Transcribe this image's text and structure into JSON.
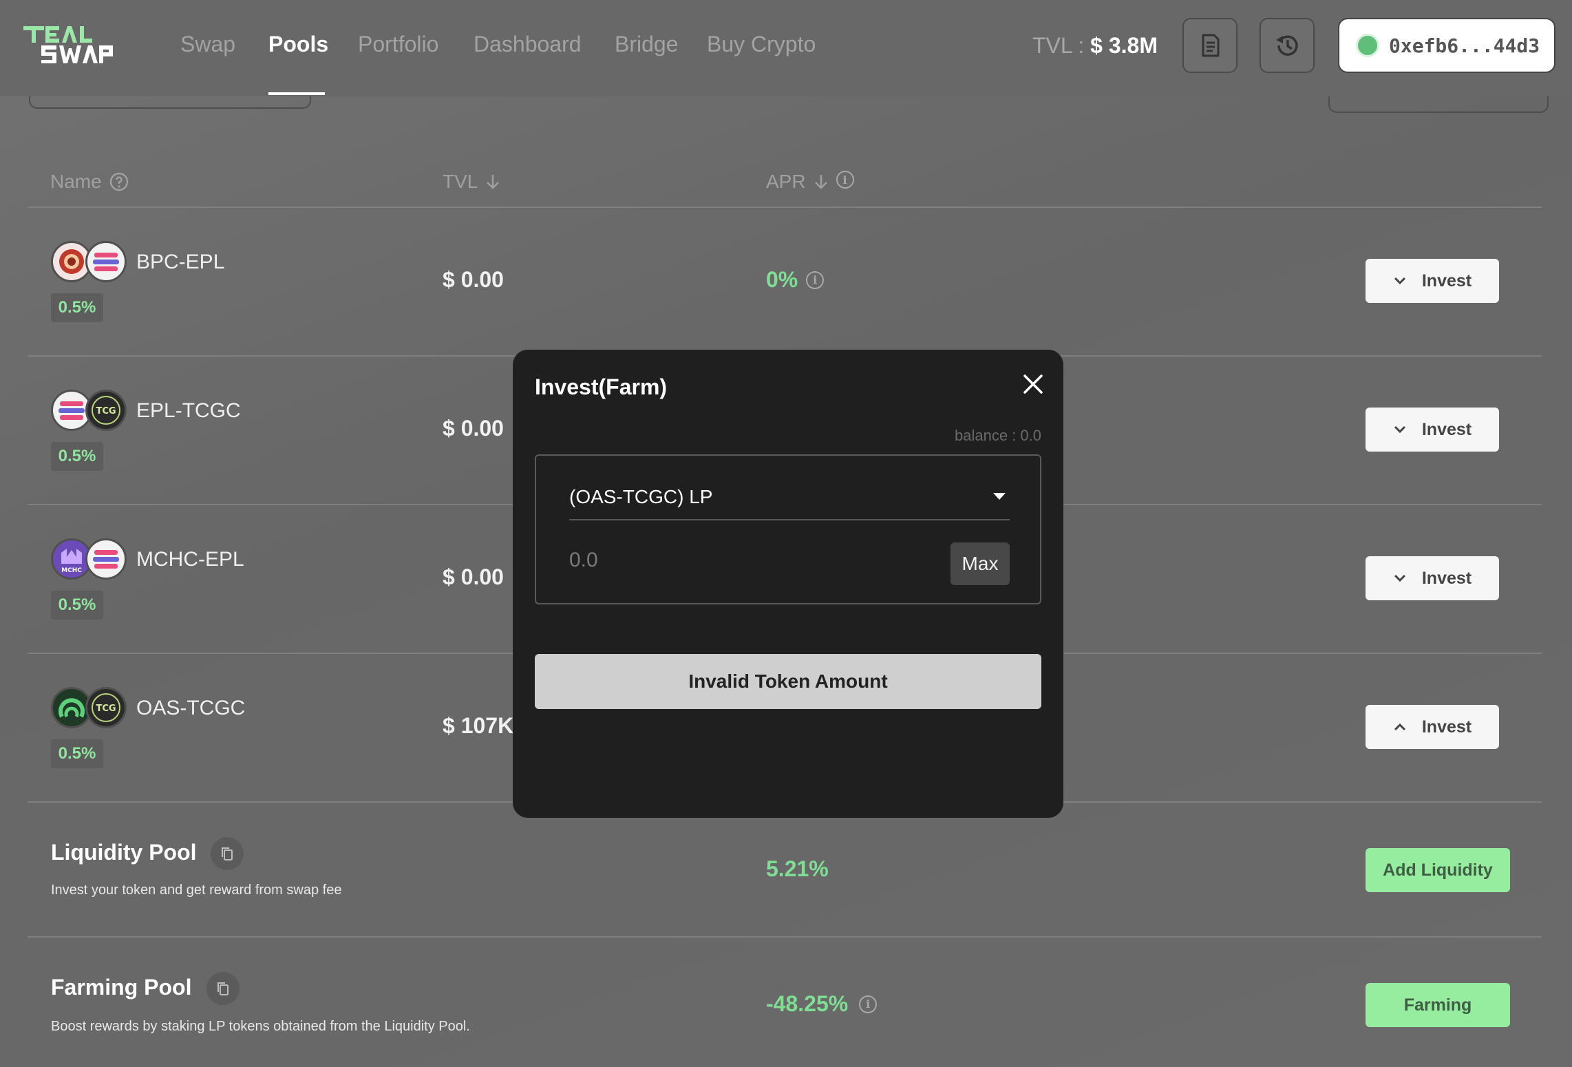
{
  "nav": {
    "logo_text": "TEAL SWAP",
    "links": [
      "Swap",
      "Pools",
      "Portfolio",
      "Dashboard",
      "Bridge",
      "Buy Crypto"
    ],
    "active_link": "Pools",
    "tvl_label": "TVL :",
    "tvl_value": "$ 3.8M",
    "wallet_address": "0xefb6...44d3"
  },
  "table": {
    "headers": {
      "name": "Name",
      "tvl": "TVL",
      "apr": "APR"
    },
    "rows": [
      {
        "pair": "BPC-EPL",
        "fee": "0.5%",
        "tvl": "$ 0.00",
        "apr": "0%",
        "action": "Invest",
        "expanded": false
      },
      {
        "pair": "EPL-TCGC",
        "fee": "0.5%",
        "tvl": "$ 0.00",
        "apr": "",
        "action": "Invest",
        "expanded": false
      },
      {
        "pair": "MCHC-EPL",
        "fee": "0.5%",
        "tvl": "$ 0.00",
        "apr": "",
        "action": "Invest",
        "expanded": false
      },
      {
        "pair": "OAS-TCGC",
        "fee": "0.5%",
        "tvl": "$ 107K",
        "apr": "",
        "action": "Invest",
        "expanded": true
      }
    ]
  },
  "liquidity_pool": {
    "title": "Liquidity Pool",
    "description": "Invest your token and get reward from swap fee",
    "apr": "5.21%",
    "button": "Add Liquidity"
  },
  "farming_pool": {
    "title": "Farming Pool",
    "description": "Boost rewards by staking LP tokens obtained from the Liquidity Pool.",
    "apr": "-48.25%",
    "button": "Farming"
  },
  "modal": {
    "title": "Invest(Farm)",
    "balance": "balance : 0.0",
    "token_selected": "(OAS-TCGC) LP",
    "amount_placeholder": "0.0",
    "max_label": "Max",
    "submit_label": "Invalid Token Amount"
  },
  "colors": {
    "accent_green": "#7fde93",
    "button_green": "#97ed9f",
    "modal_bg": "#1f1f1f",
    "overlay_bg": "#6b6b6b"
  }
}
